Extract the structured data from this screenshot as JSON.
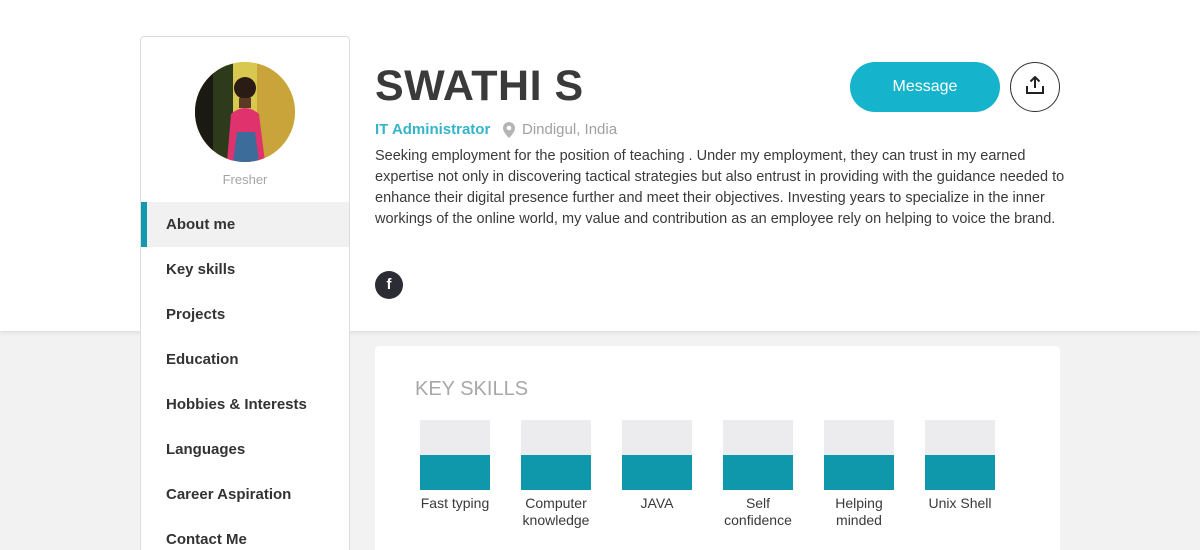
{
  "profile": {
    "name": "SWATHI S",
    "role": "IT Administrator",
    "location": "Dindigul, India",
    "status": "Fresher",
    "summary": "Seeking employment for the position of teaching . Under my employment, they can trust in my earned expertise not only in discovering tactical strategies but also entrust in providing with the guidance needed to enhance their digital presence further and meet their objectives. Investing years to specialize in the inner workings of the online world, my value and contribution as an employee rely on helping to voice the brand.",
    "facebook_label": "f"
  },
  "actions": {
    "message_label": "Message",
    "share_icon": "share-icon"
  },
  "sidebar": {
    "items": [
      {
        "label": "About me",
        "active": true
      },
      {
        "label": "Key skills",
        "active": false
      },
      {
        "label": "Projects",
        "active": false
      },
      {
        "label": "Education",
        "active": false
      },
      {
        "label": "Hobbies & Interests",
        "active": false
      },
      {
        "label": "Languages",
        "active": false
      },
      {
        "label": "Career Aspiration",
        "active": false
      },
      {
        "label": "Contact Me",
        "active": false
      }
    ]
  },
  "key_skills": {
    "title": "KEY SKILLS",
    "skills": [
      {
        "label": "Fast typing",
        "level": 0.5
      },
      {
        "label": "Computer knowledge",
        "level": 0.5
      },
      {
        "label": "JAVA",
        "level": 0.5
      },
      {
        "label": "Self confidence",
        "level": 0.5
      },
      {
        "label": "Helping minded",
        "level": 0.5
      },
      {
        "label": "Unix Shell",
        "level": 0.5
      }
    ]
  },
  "colors": {
    "accent": "#16b3cc",
    "skill_fill": "#0f97ac",
    "role": "#34b4c9"
  }
}
